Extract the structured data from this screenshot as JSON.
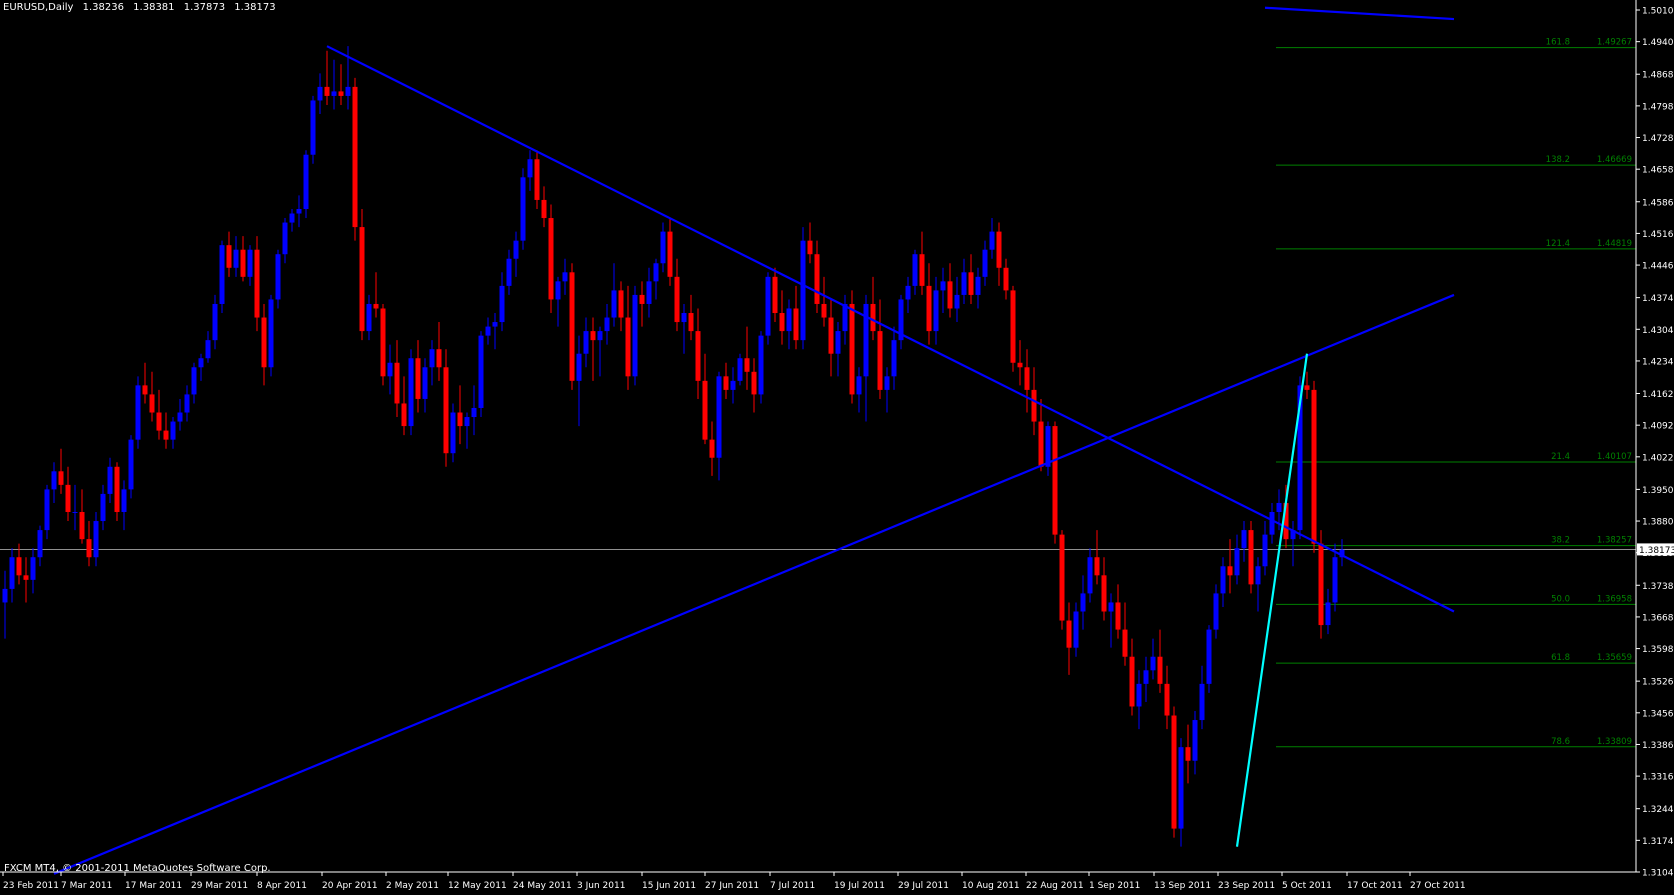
{
  "header": {
    "symbol": "EURUSD,Daily",
    "open": "1.38236",
    "high": "1.38381",
    "low": "1.37873",
    "close": "1.38173"
  },
  "footer": {
    "copyright": "FXCM MT4, © 2001-2011 MetaQuotes Software Corp."
  },
  "colors": {
    "background": "#000000",
    "bull": "#0000ff",
    "bear": "#ff0000",
    "trendline": "#0000ff",
    "cyan_line": "#00ffff",
    "fibo": "#008000",
    "axis_text": "#ffffff"
  },
  "chart_data": {
    "type": "candlestick",
    "xlabels": [
      "23 Feb 2011",
      "7 Mar 2011",
      "17 Mar 2011",
      "29 Mar 2011",
      "8 Apr 2011",
      "20 Apr 2011",
      "2 May 2011",
      "12 May 2011",
      "24 May 2011",
      "3 Jun 2011",
      "15 Jun 2011",
      "27 Jun 2011",
      "7 Jul 2011",
      "19 Jul 2011",
      "29 Jul 2011",
      "10 Aug 2011",
      "22 Aug 2011",
      "1 Sep 2011",
      "13 Sep 2011",
      "23 Sep 2011",
      "5 Oct 2011",
      "17 Oct 2011",
      "27 Oct 2011"
    ],
    "yticks": [
      "1.50100",
      "1.49400",
      "1.48680",
      "1.47980",
      "1.47280",
      "1.46580",
      "1.45860",
      "1.45160",
      "1.44460",
      "1.43740",
      "1.43040",
      "1.42340",
      "1.41620",
      "1.40920",
      "1.40220",
      "1.39500",
      "1.38800",
      "1.38100",
      "1.37380",
      "1.36680",
      "1.35980",
      "1.35260",
      "1.34560",
      "1.33860",
      "1.33160",
      "1.32440",
      "1.31740",
      "1.31040"
    ],
    "ylim": [
      1.3104,
      1.501
    ],
    "current_price": "1.38173",
    "fibo_levels": [
      {
        "label": "161.8",
        "price": "1.49267"
      },
      {
        "label": "138.2",
        "price": "1.46669"
      },
      {
        "label": "121.4",
        "price": "1.44819"
      },
      {
        "label": "21.4",
        "price": "1.40107"
      },
      {
        "label": "38.2",
        "price": "1.38257"
      },
      {
        "label": "50.0",
        "price": "1.36958"
      },
      {
        "label": "61.8",
        "price": "1.35659"
      },
      {
        "label": "78.6",
        "price": "1.33809"
      }
    ],
    "candles": [
      [
        1.37,
        1.377,
        1.362,
        1.373
      ],
      [
        1.373,
        1.382,
        1.37,
        1.38
      ],
      [
        1.38,
        1.383,
        1.374,
        1.376
      ],
      [
        1.376,
        1.38,
        1.37,
        1.375
      ],
      [
        1.375,
        1.382,
        1.372,
        1.38
      ],
      [
        1.38,
        1.387,
        1.378,
        1.386
      ],
      [
        1.386,
        1.396,
        1.384,
        1.395
      ],
      [
        1.395,
        1.401,
        1.392,
        1.399
      ],
      [
        1.399,
        1.404,
        1.394,
        1.396
      ],
      [
        1.396,
        1.4,
        1.388,
        1.39
      ],
      [
        1.39,
        1.396,
        1.386,
        1.39
      ],
      [
        1.39,
        1.395,
        1.383,
        1.384
      ],
      [
        1.384,
        1.388,
        1.378,
        1.38
      ],
      [
        1.38,
        1.39,
        1.378,
        1.388
      ],
      [
        1.388,
        1.396,
        1.386,
        1.394
      ],
      [
        1.394,
        1.402,
        1.392,
        1.4
      ],
      [
        1.4,
        1.401,
        1.388,
        1.39
      ],
      [
        1.39,
        1.397,
        1.386,
        1.395
      ],
      [
        1.395,
        1.407,
        1.393,
        1.406
      ],
      [
        1.406,
        1.42,
        1.404,
        1.418
      ],
      [
        1.418,
        1.423,
        1.414,
        1.416
      ],
      [
        1.416,
        1.421,
        1.41,
        1.412
      ],
      [
        1.412,
        1.417,
        1.406,
        1.408
      ],
      [
        1.408,
        1.412,
        1.404,
        1.406
      ],
      [
        1.406,
        1.411,
        1.404,
        1.41
      ],
      [
        1.41,
        1.415,
        1.408,
        1.412
      ],
      [
        1.412,
        1.418,
        1.41,
        1.416
      ],
      [
        1.416,
        1.423,
        1.414,
        1.422
      ],
      [
        1.422,
        1.425,
        1.419,
        1.424
      ],
      [
        1.424,
        1.43,
        1.423,
        1.428
      ],
      [
        1.428,
        1.438,
        1.426,
        1.436
      ],
      [
        1.436,
        1.45,
        1.434,
        1.449
      ],
      [
        1.449,
        1.452,
        1.442,
        1.444
      ],
      [
        1.444,
        1.451,
        1.442,
        1.448
      ],
      [
        1.448,
        1.451,
        1.441,
        1.442
      ],
      [
        1.442,
        1.449,
        1.44,
        1.448
      ],
      [
        1.448,
        1.451,
        1.43,
        1.433
      ],
      [
        1.433,
        1.436,
        1.418,
        1.422
      ],
      [
        1.422,
        1.438,
        1.42,
        1.437
      ],
      [
        1.437,
        1.448,
        1.435,
        1.447
      ],
      [
        1.447,
        1.455,
        1.445,
        1.454
      ],
      [
        1.454,
        1.457,
        1.452,
        1.456
      ],
      [
        1.456,
        1.46,
        1.453,
        1.457
      ],
      [
        1.457,
        1.47,
        1.455,
        1.469
      ],
      [
        1.469,
        1.482,
        1.467,
        1.481
      ],
      [
        1.481,
        1.487,
        1.478,
        1.484
      ],
      [
        1.484,
        1.492,
        1.48,
        1.482
      ],
      [
        1.482,
        1.49,
        1.479,
        1.483
      ],
      [
        1.483,
        1.489,
        1.48,
        1.482
      ],
      [
        1.482,
        1.493,
        1.479,
        1.484
      ],
      [
        1.484,
        1.486,
        1.45,
        1.453
      ],
      [
        1.453,
        1.457,
        1.428,
        1.43
      ],
      [
        1.43,
        1.438,
        1.428,
        1.436
      ],
      [
        1.436,
        1.443,
        1.433,
        1.435
      ],
      [
        1.435,
        1.436,
        1.418,
        1.42
      ],
      [
        1.42,
        1.427,
        1.416,
        1.423
      ],
      [
        1.423,
        1.428,
        1.411,
        1.414
      ],
      [
        1.414,
        1.42,
        1.407,
        1.409
      ],
      [
        1.409,
        1.426,
        1.407,
        1.424
      ],
      [
        1.424,
        1.428,
        1.412,
        1.415
      ],
      [
        1.415,
        1.424,
        1.412,
        1.422
      ],
      [
        1.422,
        1.428,
        1.418,
        1.426
      ],
      [
        1.426,
        1.432,
        1.419,
        1.422
      ],
      [
        1.422,
        1.426,
        1.4,
        1.403
      ],
      [
        1.403,
        1.414,
        1.401,
        1.412
      ],
      [
        1.412,
        1.418,
        1.405,
        1.409
      ],
      [
        1.409,
        1.412,
        1.404,
        1.411
      ],
      [
        1.411,
        1.418,
        1.407,
        1.413
      ],
      [
        1.413,
        1.43,
        1.411,
        1.429
      ],
      [
        1.429,
        1.433,
        1.427,
        1.431
      ],
      [
        1.431,
        1.434,
        1.426,
        1.432
      ],
      [
        1.432,
        1.443,
        1.43,
        1.44
      ],
      [
        1.44,
        1.448,
        1.438,
        1.446
      ],
      [
        1.446,
        1.452,
        1.442,
        1.45
      ],
      [
        1.45,
        1.466,
        1.448,
        1.464
      ],
      [
        1.464,
        1.47,
        1.461,
        1.468
      ],
      [
        1.468,
        1.47,
        1.457,
        1.459
      ],
      [
        1.459,
        1.462,
        1.453,
        1.455
      ],
      [
        1.455,
        1.458,
        1.434,
        1.437
      ],
      [
        1.437,
        1.442,
        1.431,
        1.441
      ],
      [
        1.441,
        1.446,
        1.438,
        1.443
      ],
      [
        1.443,
        1.445,
        1.417,
        1.419
      ],
      [
        1.419,
        1.429,
        1.409,
        1.425
      ],
      [
        1.425,
        1.433,
        1.422,
        1.43
      ],
      [
        1.43,
        1.433,
        1.419,
        1.428
      ],
      [
        1.428,
        1.431,
        1.42,
        1.43
      ],
      [
        1.43,
        1.436,
        1.427,
        1.433
      ],
      [
        1.433,
        1.445,
        1.431,
        1.439
      ],
      [
        1.439,
        1.441,
        1.43,
        1.433
      ],
      [
        1.433,
        1.44,
        1.417,
        1.42
      ],
      [
        1.42,
        1.44,
        1.418,
        1.438
      ],
      [
        1.438,
        1.441,
        1.431,
        1.436
      ],
      [
        1.436,
        1.444,
        1.433,
        1.441
      ],
      [
        1.441,
        1.446,
        1.437,
        1.445
      ],
      [
        1.445,
        1.454,
        1.443,
        1.452
      ],
      [
        1.452,
        1.455,
        1.44,
        1.442
      ],
      [
        1.442,
        1.446,
        1.43,
        1.432
      ],
      [
        1.432,
        1.436,
        1.425,
        1.434
      ],
      [
        1.434,
        1.438,
        1.428,
        1.43
      ],
      [
        1.43,
        1.435,
        1.415,
        1.419
      ],
      [
        1.419,
        1.425,
        1.405,
        1.406
      ],
      [
        1.406,
        1.41,
        1.398,
        1.402
      ],
      [
        1.402,
        1.421,
        1.397,
        1.42
      ],
      [
        1.42,
        1.423,
        1.415,
        1.417
      ],
      [
        1.417,
        1.422,
        1.414,
        1.419
      ],
      [
        1.419,
        1.425,
        1.418,
        1.424
      ],
      [
        1.424,
        1.431,
        1.417,
        1.421
      ],
      [
        1.421,
        1.424,
        1.412,
        1.416
      ],
      [
        1.416,
        1.43,
        1.414,
        1.429
      ],
      [
        1.429,
        1.443,
        1.427,
        1.442
      ],
      [
        1.442,
        1.444,
        1.432,
        1.434
      ],
      [
        1.434,
        1.439,
        1.427,
        1.43
      ],
      [
        1.43,
        1.437,
        1.426,
        1.435
      ],
      [
        1.435,
        1.44,
        1.426,
        1.428
      ],
      [
        1.428,
        1.453,
        1.426,
        1.45
      ],
      [
        1.45,
        1.454,
        1.445,
        1.447
      ],
      [
        1.447,
        1.45,
        1.434,
        1.436
      ],
      [
        1.436,
        1.442,
        1.431,
        1.433
      ],
      [
        1.433,
        1.437,
        1.42,
        1.425
      ],
      [
        1.425,
        1.432,
        1.42,
        1.43
      ],
      [
        1.43,
        1.438,
        1.427,
        1.436
      ],
      [
        1.436,
        1.439,
        1.414,
        1.416
      ],
      [
        1.416,
        1.422,
        1.412,
        1.42
      ],
      [
        1.42,
        1.438,
        1.41,
        1.436
      ],
      [
        1.436,
        1.442,
        1.428,
        1.43
      ],
      [
        1.43,
        1.437,
        1.415,
        1.417
      ],
      [
        1.417,
        1.422,
        1.412,
        1.42
      ],
      [
        1.42,
        1.431,
        1.417,
        1.428
      ],
      [
        1.428,
        1.438,
        1.426,
        1.437
      ],
      [
        1.437,
        1.442,
        1.434,
        1.44
      ],
      [
        1.44,
        1.448,
        1.438,
        1.447
      ],
      [
        1.447,
        1.452,
        1.438,
        1.44
      ],
      [
        1.44,
        1.445,
        1.427,
        1.43
      ],
      [
        1.43,
        1.442,
        1.427,
        1.439
      ],
      [
        1.439,
        1.444,
        1.434,
        1.441
      ],
      [
        1.441,
        1.445,
        1.433,
        1.435
      ],
      [
        1.435,
        1.442,
        1.432,
        1.438
      ],
      [
        1.438,
        1.446,
        1.436,
        1.443
      ],
      [
        1.443,
        1.447,
        1.436,
        1.438
      ],
      [
        1.438,
        1.444,
        1.435,
        1.442
      ],
      [
        1.442,
        1.45,
        1.44,
        1.448
      ],
      [
        1.448,
        1.455,
        1.446,
        1.452
      ],
      [
        1.452,
        1.454,
        1.44,
        1.444
      ],
      [
        1.444,
        1.446,
        1.437,
        1.439
      ],
      [
        1.439,
        1.44,
        1.421,
        1.423
      ],
      [
        1.423,
        1.428,
        1.418,
        1.422
      ],
      [
        1.422,
        1.426,
        1.412,
        1.417
      ],
      [
        1.417,
        1.422,
        1.407,
        1.41
      ],
      [
        1.41,
        1.415,
        1.399,
        1.4
      ],
      [
        1.4,
        1.41,
        1.398,
        1.409
      ],
      [
        1.409,
        1.41,
        1.383,
        1.385
      ],
      [
        1.385,
        1.386,
        1.364,
        1.366
      ],
      [
        1.366,
        1.37,
        1.354,
        1.36
      ],
      [
        1.36,
        1.37,
        1.358,
        1.368
      ],
      [
        1.368,
        1.376,
        1.364,
        1.372
      ],
      [
        1.372,
        1.382,
        1.37,
        1.38
      ],
      [
        1.38,
        1.386,
        1.374,
        1.376
      ],
      [
        1.376,
        1.38,
        1.366,
        1.368
      ],
      [
        1.368,
        1.372,
        1.36,
        1.37
      ],
      [
        1.37,
        1.374,
        1.362,
        1.364
      ],
      [
        1.364,
        1.37,
        1.356,
        1.358
      ],
      [
        1.358,
        1.362,
        1.345,
        1.347
      ],
      [
        1.347,
        1.355,
        1.342,
        1.352
      ],
      [
        1.352,
        1.358,
        1.348,
        1.355
      ],
      [
        1.355,
        1.362,
        1.353,
        1.358
      ],
      [
        1.358,
        1.364,
        1.35,
        1.352
      ],
      [
        1.352,
        1.356,
        1.342,
        1.345
      ],
      [
        1.345,
        1.347,
        1.318,
        1.32
      ],
      [
        1.32,
        1.34,
        1.316,
        1.338
      ],
      [
        1.338,
        1.343,
        1.33,
        1.335
      ],
      [
        1.335,
        1.346,
        1.332,
        1.344
      ],
      [
        1.344,
        1.356,
        1.342,
        1.352
      ],
      [
        1.352,
        1.365,
        1.35,
        1.364
      ],
      [
        1.364,
        1.374,
        1.362,
        1.372
      ],
      [
        1.372,
        1.38,
        1.369,
        1.378
      ],
      [
        1.378,
        1.384,
        1.372,
        1.376
      ],
      [
        1.376,
        1.385,
        1.374,
        1.382
      ],
      [
        1.382,
        1.388,
        1.379,
        1.386
      ],
      [
        1.386,
        1.388,
        1.372,
        1.374
      ],
      [
        1.374,
        1.38,
        1.368,
        1.378
      ],
      [
        1.378,
        1.388,
        1.376,
        1.385
      ],
      [
        1.385,
        1.392,
        1.383,
        1.39
      ],
      [
        1.39,
        1.395,
        1.386,
        1.392
      ],
      [
        1.392,
        1.396,
        1.382,
        1.384
      ],
      [
        1.384,
        1.388,
        1.378,
        1.386
      ],
      [
        1.386,
        1.42,
        1.384,
        1.418
      ],
      [
        1.418,
        1.421,
        1.415,
        1.417
      ],
      [
        1.417,
        1.419,
        1.381,
        1.383
      ],
      [
        1.383,
        1.386,
        1.362,
        1.365
      ],
      [
        1.365,
        1.373,
        1.363,
        1.37
      ],
      [
        1.37,
        1.383,
        1.368,
        1.38
      ],
      [
        1.38,
        1.384,
        1.378,
        1.3817
      ]
    ],
    "trendlines": [
      {
        "name": "upper",
        "p1": [
          46,
          1.493
        ],
        "p2": [
          207,
          1.368
        ],
        "color": "blue"
      },
      {
        "name": "lower",
        "p1": [
          7,
          1.31
        ],
        "p2": [
          207,
          1.438
        ],
        "color": "blue"
      },
      {
        "name": "top",
        "p1": [
          180,
          1.5015
        ],
        "p2": [
          207,
          1.499
        ],
        "color": "blue"
      },
      {
        "name": "fib-leg",
        "p1": [
          176,
          1.316
        ],
        "p2": [
          186,
          1.425
        ],
        "color": "cyan"
      }
    ]
  }
}
